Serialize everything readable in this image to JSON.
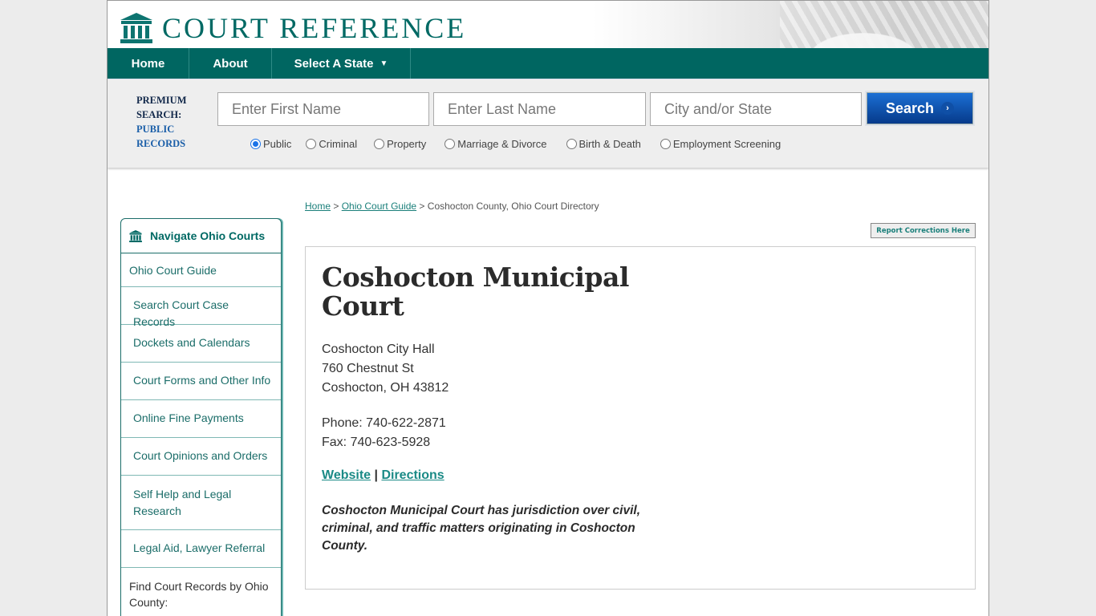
{
  "brand": {
    "name": "COURT REFERENCE",
    "accent": "#006661"
  },
  "nav": {
    "items": [
      {
        "label": "Home"
      },
      {
        "label": "About"
      },
      {
        "label": "Select A State",
        "caret": "▼"
      }
    ]
  },
  "search": {
    "premium_line1": "PREMIUM",
    "premium_line2": "SEARCH:",
    "premium_line3": "PUBLIC",
    "premium_line4": "RECORDS",
    "first_name_placeholder": "Enter First Name",
    "last_name_placeholder": "Enter Last Name",
    "city_placeholder": "City and/or State",
    "button_label": "Search",
    "button_arrow": "›",
    "options": [
      {
        "label": "Public",
        "selected": true
      },
      {
        "label": "Criminal",
        "selected": false
      },
      {
        "label": "Property",
        "selected": false
      },
      {
        "label": "Marriage & Divorce",
        "selected": false
      },
      {
        "label": "Birth & Death",
        "selected": false
      },
      {
        "label": "Employment Screening",
        "selected": false
      }
    ]
  },
  "breadcrumb": {
    "home": "Home",
    "sep": " > ",
    "guide": "Ohio Court Guide",
    "current": "Coshocton County, Ohio Court Directory"
  },
  "report_button": "Report Corrections Here",
  "sidebar": {
    "title": "Navigate Ohio Courts",
    "items": [
      {
        "label": "Ohio Court Guide"
      },
      {
        "label": "Search Court Case Records"
      },
      {
        "label": "Dockets and Calendars"
      },
      {
        "label": "Court Forms and Other Info"
      },
      {
        "label": "Online Fine Payments"
      },
      {
        "label": "Court Opinions and Orders"
      },
      {
        "label": "Self Help and Legal Research"
      },
      {
        "label": "Legal Aid, Lawyer Referral"
      }
    ],
    "footer": "Find Court Records by Ohio County:"
  },
  "court": {
    "name": "Coshocton Municipal Court",
    "address_line1": "Coshocton City Hall",
    "address_line2": "760 Chestnut St",
    "address_line3": "Coshocton, OH 43812",
    "phone": "Phone: 740-622-2871",
    "fax": "Fax: 740-623-5928",
    "website_label": "Website",
    "link_sep": " | ",
    "directions_label": "Directions",
    "description": "Coshocton Municipal Court has jurisdiction over civil, criminal, and traffic matters originating in Coshocton County."
  }
}
